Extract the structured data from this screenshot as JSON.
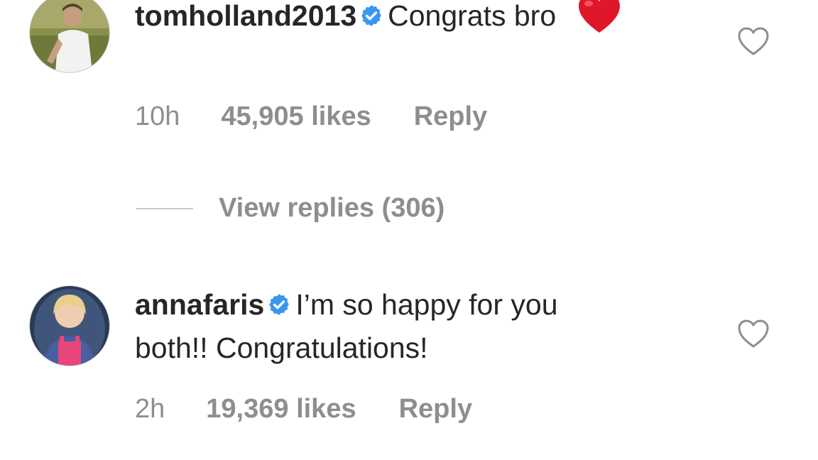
{
  "comments": [
    {
      "username": "tomholland2013",
      "verified": true,
      "text": "Congrats bro",
      "emoji": "❤️",
      "time": "10h",
      "likes": "45,905 likes",
      "reply_label": "Reply"
    },
    {
      "username": "annafaris",
      "verified": true,
      "text": "I’m so happy for you both!! Congratulations!",
      "time": "2h",
      "likes": "19,369 likes",
      "reply_label": "Reply"
    }
  ],
  "view_replies": "View replies (306)",
  "colors": {
    "text": "#262626",
    "meta": "#8e8e8e",
    "verified": "#3897f0",
    "heart_emoji": "#e0162b"
  },
  "icons": [
    "avatar",
    "verified-badge-icon",
    "heart-outline-icon",
    "red-heart-emoji"
  ]
}
